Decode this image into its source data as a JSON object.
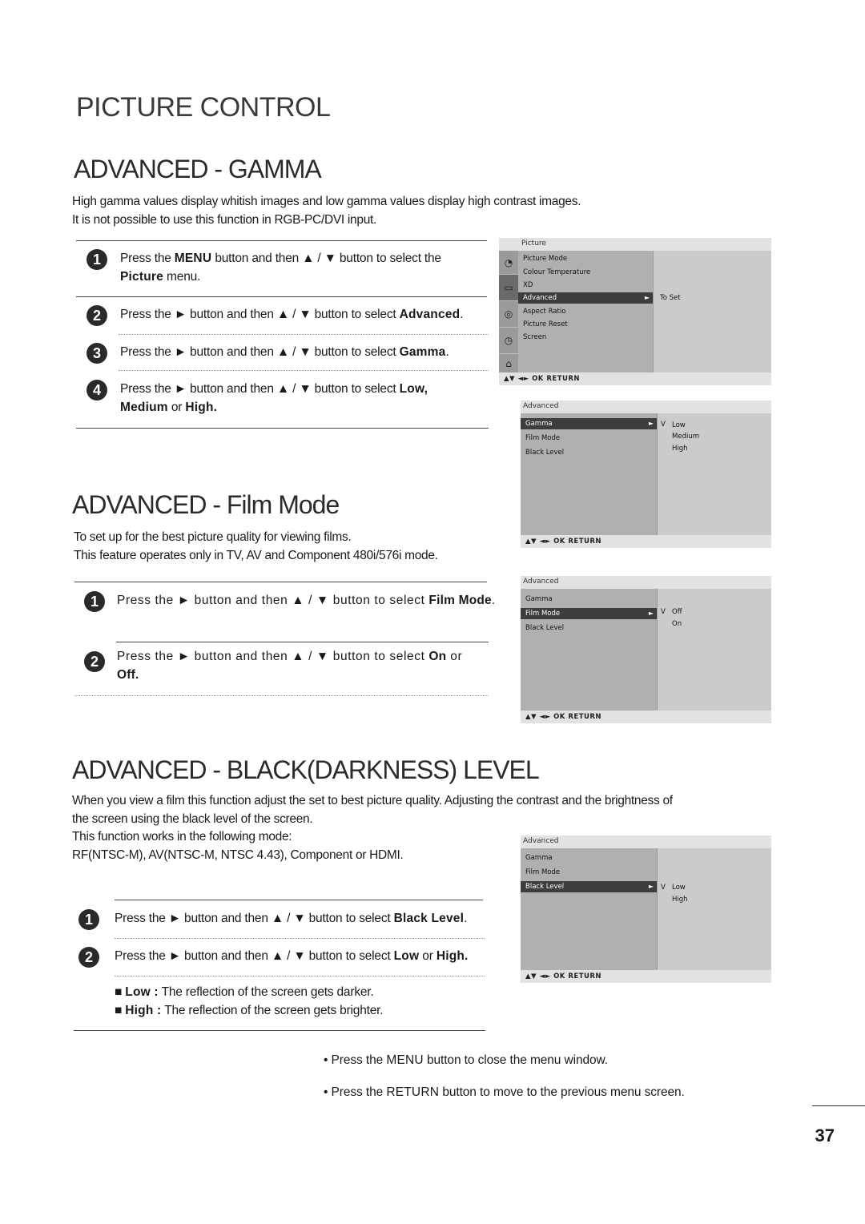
{
  "page_title": "PICTURE CONTROL",
  "gamma": {
    "title": "ADVANCED - GAMMA",
    "desc": [
      "High gamma values display whitish images and low gamma values display high contrast images.",
      "It is not possible to use this function in RGB-PC/DVI input."
    ],
    "steps": [
      {
        "num": "1",
        "pre": "Press the ",
        "b1": "MENU",
        "mid": " button and then ▲ / ▼ button to select the ",
        "b2": "Picture",
        "post": "  menu."
      },
      {
        "num": "2",
        "pre": "Press the ► button and then ▲ / ▼ button to select ",
        "b1": "Advanced",
        "post": "."
      },
      {
        "num": "3",
        "pre": "Press the ► button and then ▲ / ▼ button to select ",
        "b1": "Gamma",
        "post": "."
      },
      {
        "num": "4",
        "pre": "Press the ► button and then ▲ / ▼ button to select ",
        "b1": "Low,",
        "mid": " ",
        "b2": "Medium",
        "mid2": " or ",
        "b3": "High."
      }
    ]
  },
  "film": {
    "title": "ADVANCED - Film Mode",
    "desc": [
      "To set up for the best picture quality for viewing films.",
      "This feature operates only in TV, AV and Component 480i/576i mode."
    ],
    "steps": [
      {
        "num": "1",
        "pre": "Press the  ► button and then ▲ / ▼ button to select ",
        "b1": "Film Mode",
        "post": "."
      },
      {
        "num": "2",
        "pre": "Press the  ► button and then ▲ / ▼ button to select ",
        "b1": "On",
        "mid": " or ",
        "b2": "Off."
      }
    ]
  },
  "black": {
    "title": "ADVANCED - BLACK(DARKNESS) LEVEL",
    "desc": [
      "When you view a film this function adjust the set to best picture quality. Adjusting the contrast and the brightness of",
      "the screen using the black level of the screen.",
      "This function works in the following mode:",
      "RF(NTSC-M), AV(NTSC-M, NTSC 4.43), Component or HDMI."
    ],
    "steps": [
      {
        "num": "1",
        "pre": "Press the ► button and then ▲ / ▼  button to select ",
        "b1": "Black Level",
        "post": "."
      },
      {
        "num": "2",
        "pre": "Press the ► button and then ▲ / ▼  button to select ",
        "b1": "Low",
        "mid": " or ",
        "b2": "High."
      }
    ],
    "bullets": [
      {
        "label": "Low :",
        "text": " The reflection of the screen gets darker."
      },
      {
        "label": "High :",
        "text": " The reflection of the screen gets brighter."
      }
    ]
  },
  "osd_footer": "▲▼  ◄►  OK   RETURN",
  "osd_picture": {
    "header": "Picture",
    "items": [
      "Picture Mode",
      "Colour Temperature",
      "XD",
      "Advanced",
      "Aspect Ratio",
      "Picture Reset",
      "Screen"
    ],
    "selected_index": 3,
    "side_label": "To Set",
    "icons": [
      "satellite-dish-icon",
      "tv-screen-icon",
      "speaker-icon",
      "clock-icon",
      "lock-icon"
    ]
  },
  "osd_gamma": {
    "header": "Advanced",
    "items": [
      "Gamma",
      "Film Mode",
      "Black Level"
    ],
    "selected_index": 0,
    "check": "V",
    "options": [
      "Low",
      "Medium",
      "High"
    ]
  },
  "osd_film": {
    "header": "Advanced",
    "items": [
      "Gamma",
      "Film Mode",
      "Black Level"
    ],
    "selected_index": 1,
    "check": "V",
    "options": [
      "Off",
      "On"
    ]
  },
  "osd_black": {
    "header": "Advanced",
    "items": [
      "Gamma",
      "Film Mode",
      "Black Level"
    ],
    "selected_index": 2,
    "check": "V",
    "options": [
      "Low",
      "High"
    ]
  },
  "notes": [
    {
      "pre": "• Press the ",
      "b": "MENU",
      "post": " button to close the menu window."
    },
    {
      "pre": "• Press the ",
      "b": "RETURN",
      "post": " button to move to the previous menu screen."
    }
  ],
  "page_number": "37",
  "arrow": "►"
}
